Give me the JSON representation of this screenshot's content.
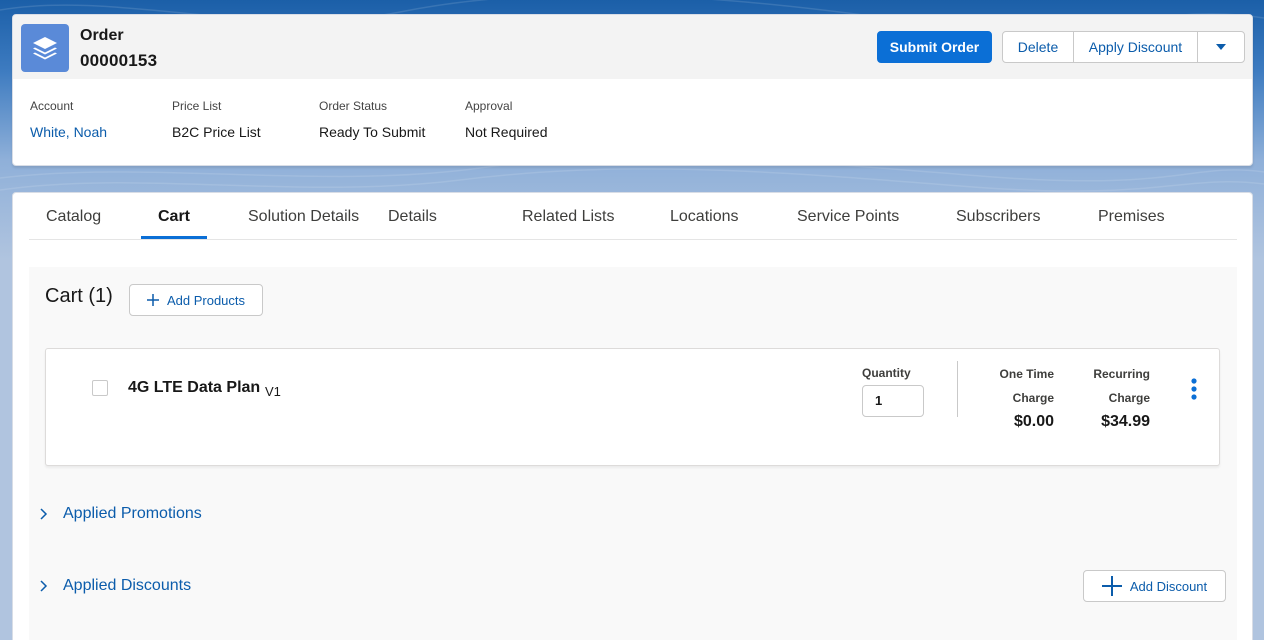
{
  "header": {
    "record_type": "Order",
    "record_name": "00000153",
    "actions": {
      "submit": "Submit Order",
      "delete": "Delete",
      "apply_discount": "Apply Discount"
    },
    "fields": [
      {
        "label": "Account",
        "value": "White, Noah"
      },
      {
        "label": "Price List",
        "value": "B2C Price List"
      },
      {
        "label": "Order Status",
        "value": "Ready To Submit"
      },
      {
        "label": "Approval",
        "value": "Not Required"
      }
    ]
  },
  "tabs": [
    {
      "label": "Catalog"
    },
    {
      "label": "Cart"
    },
    {
      "label": "Solution Details"
    },
    {
      "label": "Details"
    },
    {
      "label": "Related Lists"
    },
    {
      "label": "Locations"
    },
    {
      "label": "Service Points"
    },
    {
      "label": "Subscribers"
    },
    {
      "label": "Premises"
    }
  ],
  "active_tab": "Cart",
  "cart": {
    "title": "Cart (1)",
    "add_products_label": "Add Products",
    "items": [
      {
        "name": "4G LTE Data Plan",
        "version": "V1",
        "quantity_label": "Quantity",
        "quantity": "1",
        "one_time_label_1": "One Time",
        "one_time_label_2": "Charge",
        "one_time_value": "$0.00",
        "recurring_label_1": "Recurring",
        "recurring_label_2": "Charge",
        "recurring_value": "$34.99"
      }
    ],
    "applied_promotions_label": "Applied Promotions",
    "applied_discounts_label": "Applied Discounts",
    "add_discount_label": "Add Discount"
  },
  "colors": {
    "brand": "#0b6fd6",
    "link": "#0b5cab",
    "icon_bg": "#5a8ad8"
  },
  "icons": {
    "record": "stacked-layers-icon",
    "menu": "chevron-down-icon",
    "add": "plus-icon",
    "more": "kebab-icon",
    "expand": "chevron-right-icon"
  }
}
